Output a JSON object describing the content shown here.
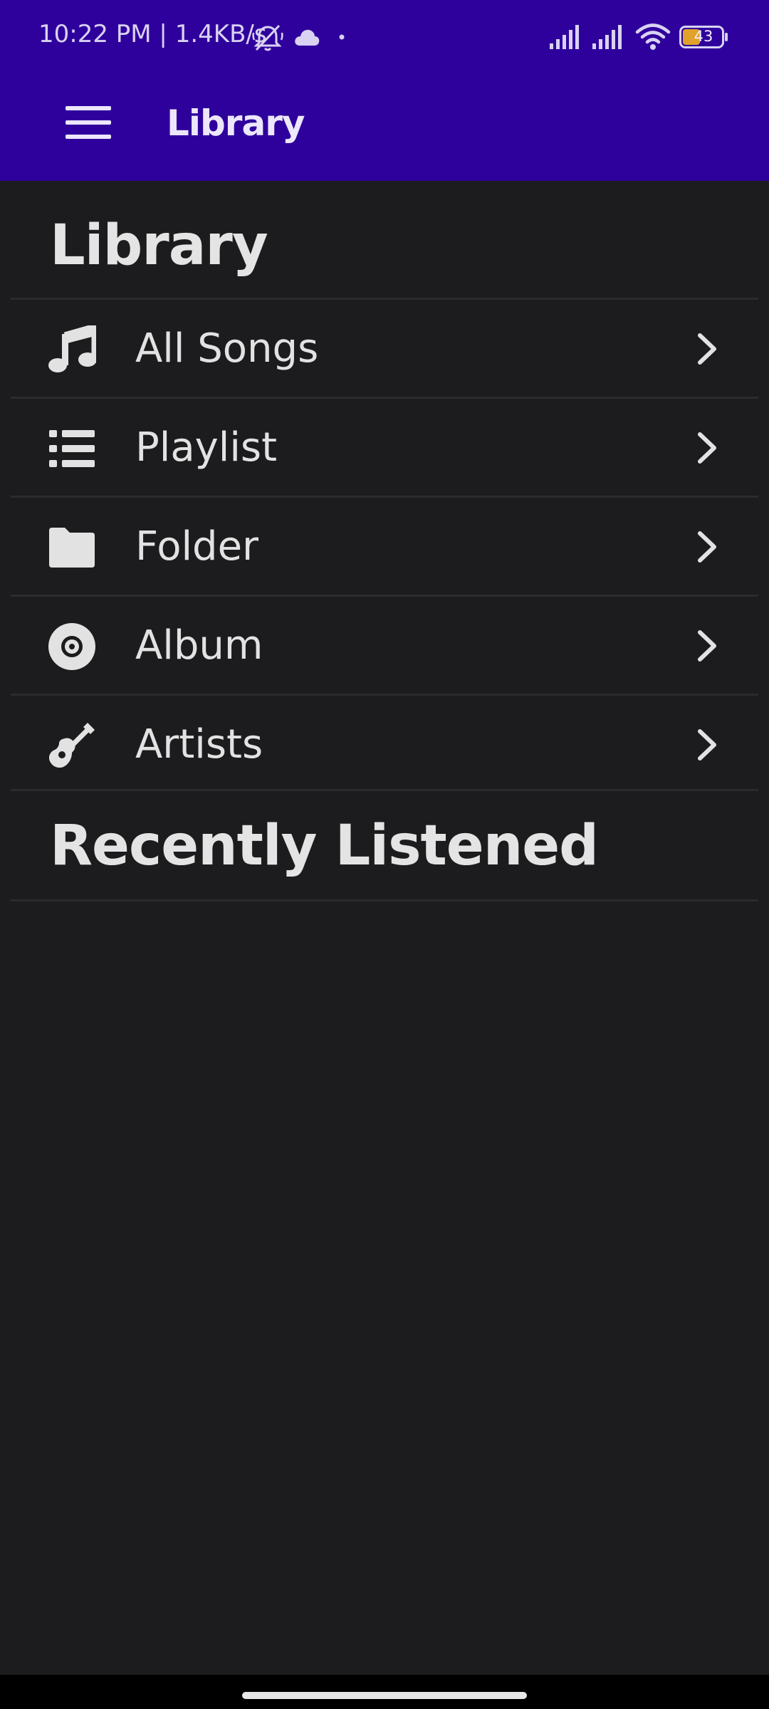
{
  "status_bar": {
    "time_text": "10:22 PM | 1.4KB/s",
    "battery_level": "43",
    "icons": [
      "mute-bell-icon",
      "cloud-icon",
      "dot-icon",
      "signal-icon",
      "signal-icon",
      "wifi-icon",
      "battery-icon"
    ]
  },
  "toolbar": {
    "title": "Library",
    "menu_icon": "hamburger-menu-icon"
  },
  "library": {
    "heading": "Library",
    "items": [
      {
        "label": "All Songs",
        "icon": "music-note-icon"
      },
      {
        "label": "Playlist",
        "icon": "list-icon"
      },
      {
        "label": "Folder",
        "icon": "folder-icon"
      },
      {
        "label": "Album",
        "icon": "disc-icon"
      },
      {
        "label": "Artists",
        "icon": "guitar-icon"
      }
    ]
  },
  "recent": {
    "heading": "Recently Listened"
  },
  "colors": {
    "header": "#2f019c",
    "background": "#1c1c1e",
    "text": "#e2e2e2",
    "divider": "#2b2b2d"
  }
}
